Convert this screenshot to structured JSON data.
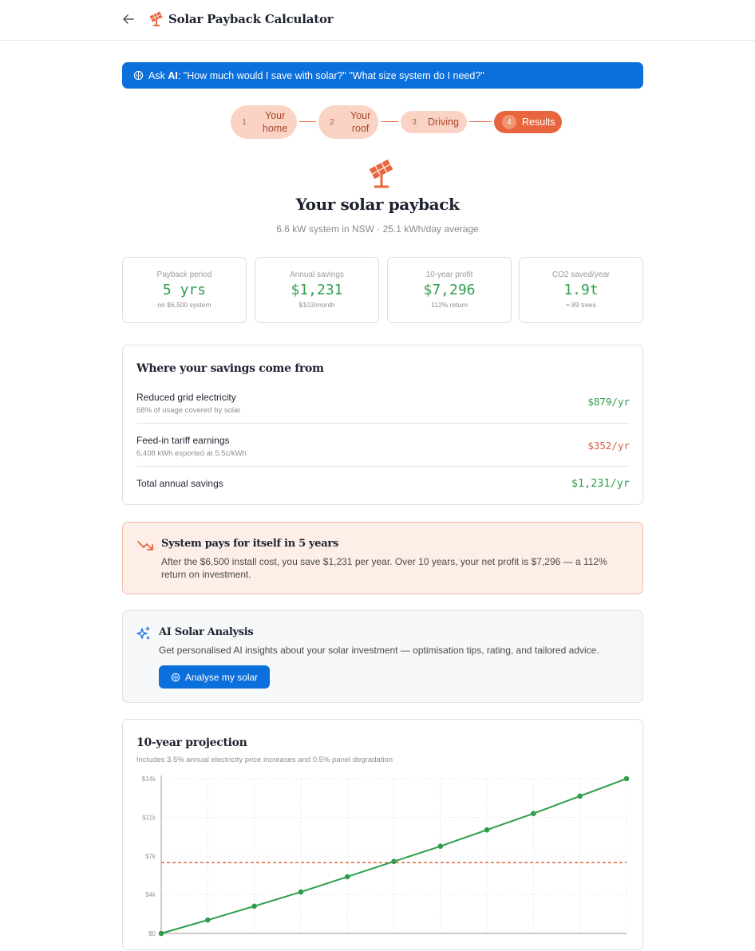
{
  "header": {
    "title": "Solar Payback Calculator",
    "back_icon": "arrow-left-icon",
    "logo_icon": "solar-panel-icon"
  },
  "ask": {
    "prefix": "Ask ",
    "ai": "AI",
    "prompt": ": \"How much would I save with solar?\" \"What size system do I need?\""
  },
  "steps": [
    {
      "num": "1",
      "label_line1": "Your",
      "label_line2": "home"
    },
    {
      "num": "2",
      "label_line1": "Your",
      "label_line2": "roof"
    },
    {
      "num": "3",
      "label_line1": "Driving",
      "label_line2": ""
    },
    {
      "num": "4",
      "label_line1": "Results",
      "label_line2": ""
    }
  ],
  "hero": {
    "title": "Your solar payback",
    "subtitle": "6.6 kW system in NSW · 25.1 kWh/day average"
  },
  "stats": [
    {
      "caption": "Payback period",
      "value": "5 yrs",
      "foot": "on $6,500 system"
    },
    {
      "caption": "Annual savings",
      "value": "$1,231",
      "foot": "$103/month"
    },
    {
      "caption": "10-year profit",
      "value": "$7,296",
      "foot": "112% return"
    },
    {
      "caption": "CO2 saved/year",
      "value": "1.9t",
      "foot": "≈ 89 trees"
    }
  ],
  "savings": {
    "title": "Where your savings come from",
    "rows": [
      {
        "name": "Reduced grid electricity",
        "desc": "68% of usage covered by solar",
        "amount": "$879/yr"
      },
      {
        "name": "Feed-in tariff earnings",
        "desc": "6,408 kWh exported at 5.5c/kWh",
        "amount": "$352/yr"
      },
      {
        "name": "Total annual savings",
        "desc": "",
        "amount": "$1,231/yr"
      }
    ]
  },
  "payback": {
    "title": "System pays for itself in 5 years",
    "text": "After the $6,500 install cost, you save $1,231 per year. Over 10 years, your net profit is $7,296 — a 112% return on investment."
  },
  "ai_analysis": {
    "title": "AI Solar Analysis",
    "text": "Get personalised AI insights about your solar investment — optimisation tips, rating, and tailored advice.",
    "button": "Analyse my solar"
  },
  "projection": {
    "title": "10-year projection",
    "subtitle": "Includes 3.5% annual electricity price increases and 0.5% panel degradation"
  },
  "colors": {
    "accent_blue": "#0b6fdc",
    "accent_orange": "#e8663d",
    "green": "#2e9e4d"
  },
  "chart_data": {
    "type": "line",
    "title": "10-year projection",
    "x": [
      0,
      1,
      2,
      3,
      4,
      5,
      6,
      7,
      8,
      9,
      10
    ],
    "series": [
      {
        "values": [
          0,
          1231,
          2500,
          3800,
          5200,
          6600,
          8000,
          9500,
          11000,
          12600,
          14200
        ],
        "color": "#2e9e4d"
      }
    ],
    "reference_line": {
      "value": 6500,
      "color": "#e8663d",
      "style": "dashed"
    },
    "y_ticks": [
      "$0",
      "$4k",
      "$7k",
      "$11k",
      "$14k"
    ],
    "y_tick_values": [
      0,
      3600,
      7100,
      10650,
      14200
    ],
    "ylim": [
      0,
      14200
    ],
    "grid": true
  }
}
